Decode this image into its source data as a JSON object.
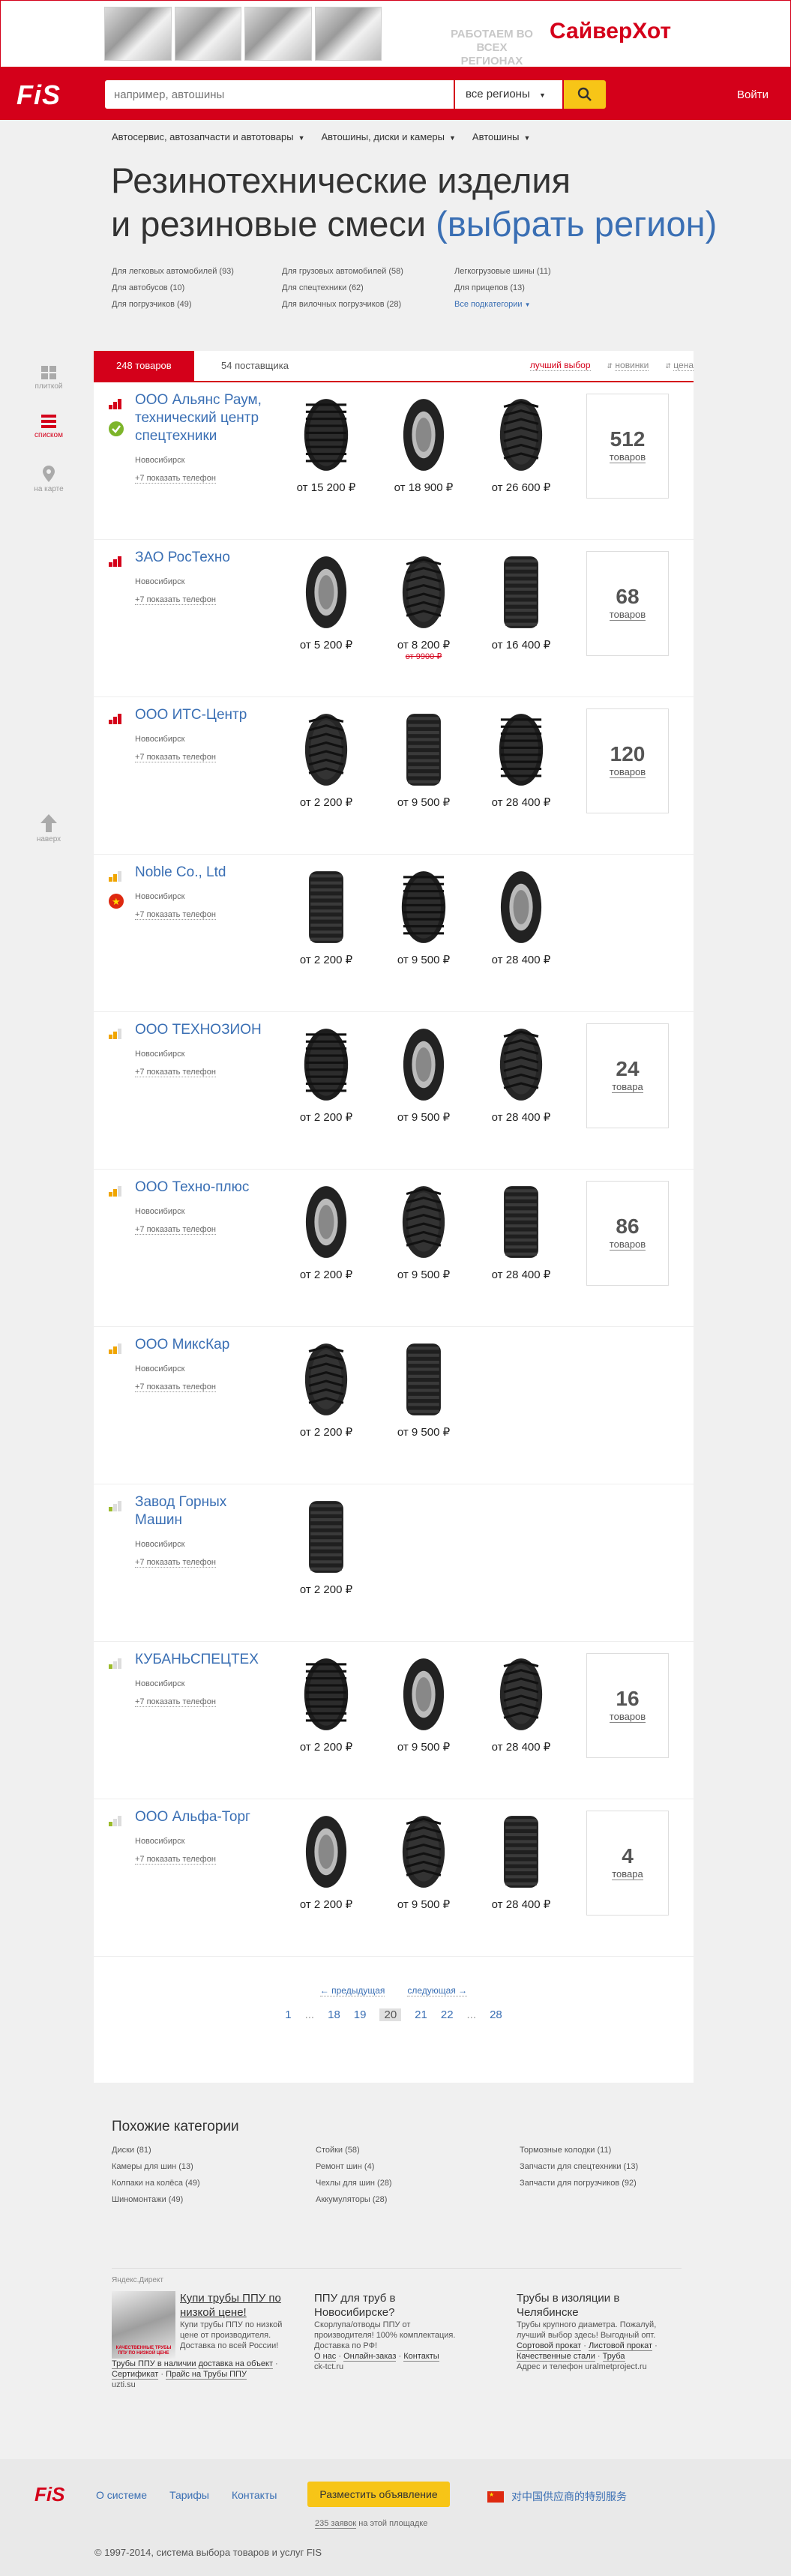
{
  "banner": {
    "ghost_text": "РАБОТАЕМ ВО ВСЕХ РЕГИОНАХ",
    "brand": "СайверХот"
  },
  "header": {
    "logo": "FiS",
    "search_placeholder": "например, автошины",
    "region": "все регионы",
    "login": "Войти"
  },
  "topnav": [
    "Автосервис, автозапчасти и автотовары",
    "Автошины, диски и камеры",
    "Автошины"
  ],
  "page": {
    "title_line1": "Резинотехнические изделия",
    "title_line2": "и резиновые смеси",
    "title_link": "(выбрать регион)"
  },
  "subcats": [
    "Для легковых автомобилей (93)",
    "Для грузовых автомобилей (58)",
    "Легкогрузовые шины (11)",
    "Для автобусов (10)",
    "Для спецтехники (62)",
    "Для прицепов (13)",
    "Для погрузчиков (49)",
    "Для вилочных погрузчиков (28)",
    "Все подкатегории"
  ],
  "side": {
    "tiles": "плиткой",
    "list": "списком",
    "map": "на карте",
    "up": "наверх"
  },
  "tabs": {
    "goods": "248 товаров",
    "suppliers": "54 поставщика"
  },
  "sorts": {
    "best": "лучший выбор",
    "new": "новинки",
    "price": "цена"
  },
  "company_common": {
    "city": "Новосибирск",
    "phone": "+7 показать телефон"
  },
  "companies": [
    {
      "name": "ООО Альянс Раум, технический центр спецтехники",
      "level": 3,
      "badge": "check",
      "prices": [
        "от 15 200 ₽",
        "от 18 900 ₽",
        "от 26 600 ₽"
      ],
      "old": "",
      "count": "512",
      "count_label": "товаров"
    },
    {
      "name": "ЗАО РосТехно",
      "level": 3,
      "badge": "",
      "prices": [
        "от 5 200 ₽",
        "от 8 200 ₽",
        "от 16 400 ₽"
      ],
      "old": "от 9900 ₽",
      "count": "68",
      "count_label": "товаров"
    },
    {
      "name": "ООО ИТС-Центр",
      "level": 3,
      "badge": "",
      "prices": [
        "от 2 200 ₽",
        "от 9 500 ₽",
        "от 28 400 ₽"
      ],
      "old": "",
      "count": "120",
      "count_label": "товаров"
    },
    {
      "name": "Noble Co., Ltd",
      "level": 2,
      "badge": "cn",
      "prices": [
        "от 2 200 ₽",
        "от 9 500 ₽",
        "от 28 400 ₽"
      ],
      "old": "",
      "count": "",
      "count_label": ""
    },
    {
      "name": "ООО ТЕХНОЗИОН",
      "level": 2,
      "badge": "",
      "prices": [
        "от 2 200 ₽",
        "от 9 500 ₽",
        "от 28 400 ₽"
      ],
      "old": "",
      "count": "24",
      "count_label": "товара"
    },
    {
      "name": "ООО Техно-плюс",
      "level": 2,
      "badge": "",
      "prices": [
        "от 2 200 ₽",
        "от 9 500 ₽",
        "от 28 400 ₽"
      ],
      "old": "",
      "count": "86",
      "count_label": "товаров"
    },
    {
      "name": "ООО МиксКар",
      "level": 2,
      "badge": "",
      "prices": [
        "от 2 200 ₽",
        "от 9 500 ₽"
      ],
      "old": "",
      "count": "",
      "count_label": ""
    },
    {
      "name": "Завод Горных Машин",
      "level": 1,
      "badge": "",
      "prices": [
        "от 2 200 ₽"
      ],
      "old": "",
      "count": "",
      "count_label": ""
    },
    {
      "name": "КУБАНЬСПЕЦТЕХ",
      "level": 1,
      "badge": "",
      "prices": [
        "от 2 200 ₽",
        "от 9 500 ₽",
        "от 28 400 ₽"
      ],
      "old": "",
      "count": "16",
      "count_label": "товаров"
    },
    {
      "name": "ООО Альфа-Торг",
      "level": 1,
      "badge": "",
      "prices": [
        "от 2 200 ₽",
        "от 9 500 ₽",
        "от 28 400 ₽"
      ],
      "old": "",
      "count": "4",
      "count_label": "товара"
    }
  ],
  "pager": {
    "prev": "← предыдущая",
    "next": "следующая →",
    "pages": [
      "1",
      "...",
      "18",
      "19",
      "20",
      "21",
      "22",
      "...",
      "28"
    ],
    "current": "20"
  },
  "similar": {
    "title": "Похожие категории",
    "items": [
      "Диски (81)",
      "Стойки (58)",
      "Тормозные колодки (11)",
      "Камеры для шин (13)",
      "Ремонт шин (4)",
      "Запчасти для спецтехники (13)",
      "Колпаки на колёса (49)",
      "Чехлы для шин (28)",
      "Запчасти для погрузчиков (92)",
      "Шиномонтажи (49)",
      "Аккумуляторы (28)"
    ]
  },
  "ads": {
    "label": "Яндекс.Директ",
    "ad1": {
      "title": "Купи трубы ППУ по низкой цене!",
      "img_text": "КАЧЕСТВЕННЫЕ ТРУБЫ ППУ ПО НИЗКОЙ ЦЕНЕ",
      "body": "Купи трубы ППУ по низкой цене от производителя. Доставка по всей России!",
      "links": [
        "Трубы ППУ в наличии",
        "доставка на объект",
        "Сертификат",
        "Прайс на Трубы ППУ"
      ],
      "domain": "uzti.su"
    },
    "ad2": {
      "title": "ППУ для труб в Новосибирске?",
      "body": "Скорлупа/отводы ППУ от производителя! 100% комплектация. Доставка по РФ!",
      "links": [
        "О нас",
        "Онлайн-заказ",
        "Контакты"
      ],
      "domain": "ck-tct.ru"
    },
    "ad3": {
      "title": "Трубы в изоляции в Челябинске",
      "body": "Трубы крупного диаметра. Пожалуй, лучший выбор здесь! Выгодный опт.",
      "links": [
        "Сортовой прокат",
        "Листовой прокат",
        "Качественные стали",
        "Труба"
      ],
      "domain": "Адрес и телефон uralmetproject.ru"
    }
  },
  "footer": {
    "logo": "FiS",
    "links": [
      "О системе",
      "Тарифы",
      "Контакты"
    ],
    "place_ad": "Разместить объявление",
    "ads_count_link": "235 заявок",
    "ads_count_text": " на этой площадке",
    "cn_text": "对中国供应商的特别服务",
    "copyright": "© 1997-2014, система выбора товаров и услуг FIS"
  },
  "colors": {
    "brand_red": "#d4001a",
    "accent_yellow": "#f7c517",
    "link_blue": "#3a6fb4"
  }
}
